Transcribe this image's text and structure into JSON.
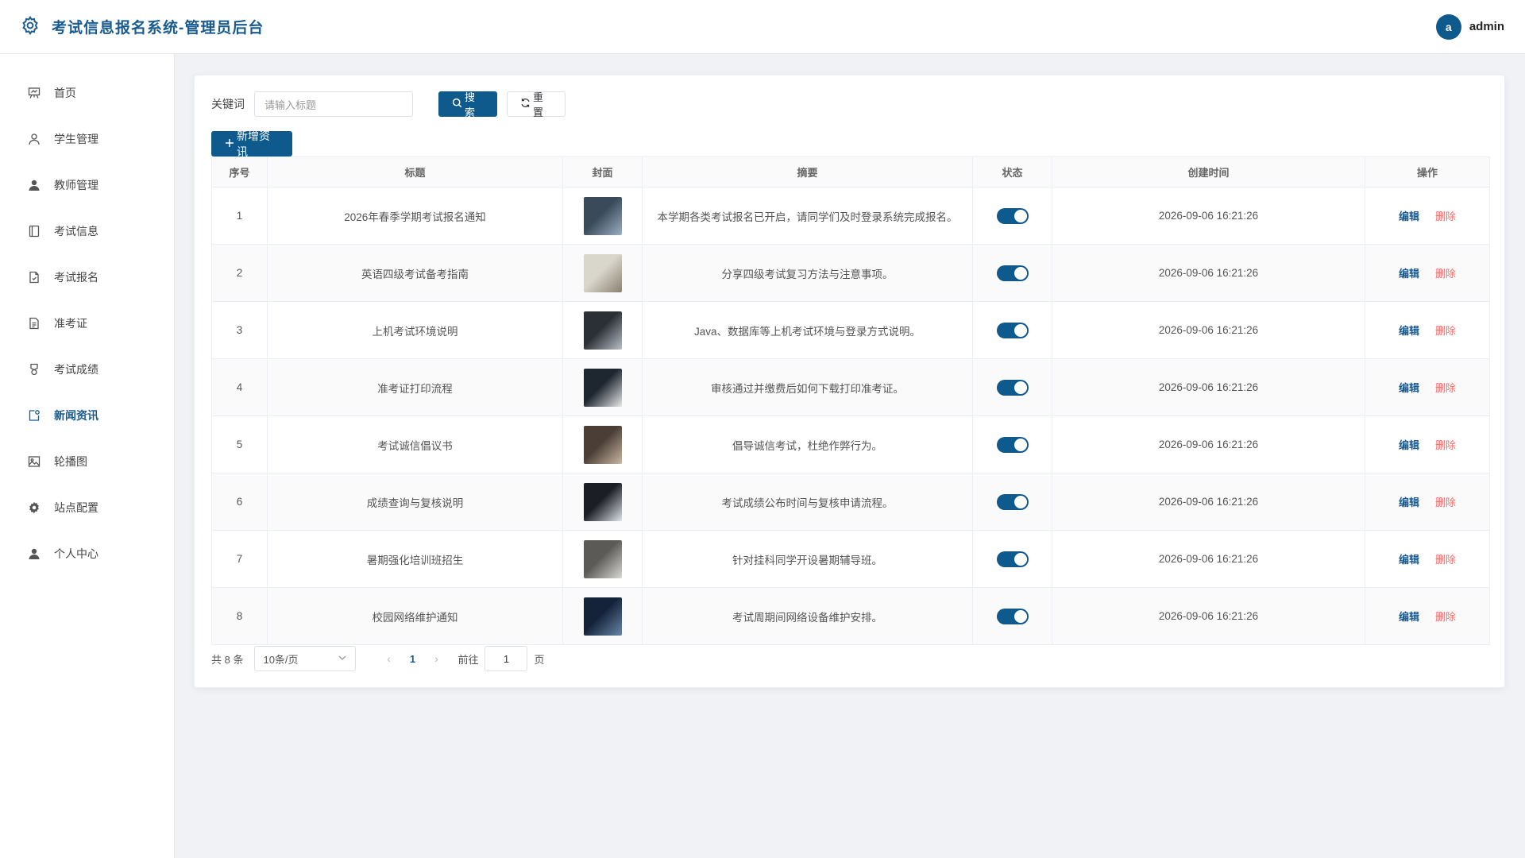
{
  "header": {
    "title": "考试信息报名系统-管理员后台",
    "avatar_letter": "a",
    "username": "admin"
  },
  "sidebar": {
    "items": [
      {
        "label": "首页",
        "icon": "home-icon",
        "active": false
      },
      {
        "label": "学生管理",
        "icon": "user-icon",
        "active": false
      },
      {
        "label": "教师管理",
        "icon": "user-filled-icon",
        "active": false
      },
      {
        "label": "考试信息",
        "icon": "notebook-icon",
        "active": false
      },
      {
        "label": "考试报名",
        "icon": "document-icon",
        "active": false
      },
      {
        "label": "准考证",
        "icon": "ticket-icon",
        "active": false
      },
      {
        "label": "考试成绩",
        "icon": "medal-icon",
        "active": false
      },
      {
        "label": "新闻资讯",
        "icon": "news-icon",
        "active": true
      },
      {
        "label": "轮播图",
        "icon": "picture-icon",
        "active": false
      },
      {
        "label": "站点配置",
        "icon": "setting-icon",
        "active": false
      },
      {
        "label": "个人中心",
        "icon": "user-center-icon",
        "active": false
      }
    ]
  },
  "search": {
    "label": "关键词",
    "placeholder": "请输入标题",
    "search_label": "搜索",
    "reset_label": "重置"
  },
  "toolbar": {
    "add_label": "新增资讯"
  },
  "table": {
    "columns": [
      "序号",
      "标题",
      "封面",
      "摘要",
      "状态",
      "创建时间",
      "操作"
    ],
    "rows": [
      {
        "id": "1",
        "title": "2026年春季学期考试报名通知",
        "summary": "本学期各类考试报名已开启，请同学们及时登录系统完成报名。",
        "status": true,
        "created": "2026-09-06 16:21:26",
        "thumb_colors": [
          "#3a4a5a",
          "#9bb0c4"
        ]
      },
      {
        "id": "2",
        "title": "英语四级考试备考指南",
        "summary": "分享四级考试复习方法与注意事项。",
        "status": true,
        "created": "2026-09-06 16:21:26",
        "thumb_colors": [
          "#d9d6cc",
          "#8a8070"
        ]
      },
      {
        "id": "3",
        "title": "上机考试环境说明",
        "summary": "Java、数据库等上机考试环境与登录方式说明。",
        "status": true,
        "created": "2026-09-06 16:21:26",
        "thumb_colors": [
          "#2b2f36",
          "#b8c0c8"
        ]
      },
      {
        "id": "4",
        "title": "准考证打印流程",
        "summary": "审核通过并缴费后如何下载打印准考证。",
        "status": true,
        "created": "2026-09-06 16:21:26",
        "thumb_colors": [
          "#1e2630",
          "#e8e8e8"
        ]
      },
      {
        "id": "5",
        "title": "考试诚信倡议书",
        "summary": "倡导诚信考试，杜绝作弊行为。",
        "status": true,
        "created": "2026-09-06 16:21:26",
        "thumb_colors": [
          "#4a3e36",
          "#c9b8a4"
        ]
      },
      {
        "id": "6",
        "title": "成绩查询与复核说明",
        "summary": "考试成绩公布时间与复核申请流程。",
        "status": true,
        "created": "2026-09-06 16:21:26",
        "thumb_colors": [
          "#1b1e24",
          "#dfe4ea"
        ]
      },
      {
        "id": "7",
        "title": "暑期强化培训班招生",
        "summary": "针对挂科同学开设暑期辅导班。",
        "status": true,
        "created": "2026-09-06 16:21:26",
        "thumb_colors": [
          "#5c5a56",
          "#d8d8d4"
        ]
      },
      {
        "id": "8",
        "title": "校园网络维护通知",
        "summary": "考试周期间网络设备维护安排。",
        "status": true,
        "created": "2026-09-06 16:21:26",
        "thumb_colors": [
          "#14233a",
          "#6a86a8"
        ]
      }
    ],
    "edit_label": "编辑",
    "delete_label": "删除"
  },
  "pagination": {
    "total": "共 8 条",
    "page_size": "10条/页",
    "current": "1",
    "goto_prefix": "前往",
    "goto_value": "1",
    "goto_suffix": "页"
  },
  "colors": {
    "accent": "#0f5a8c",
    "danger": "#f56c6c",
    "brand_text": "#1a5b8f"
  }
}
